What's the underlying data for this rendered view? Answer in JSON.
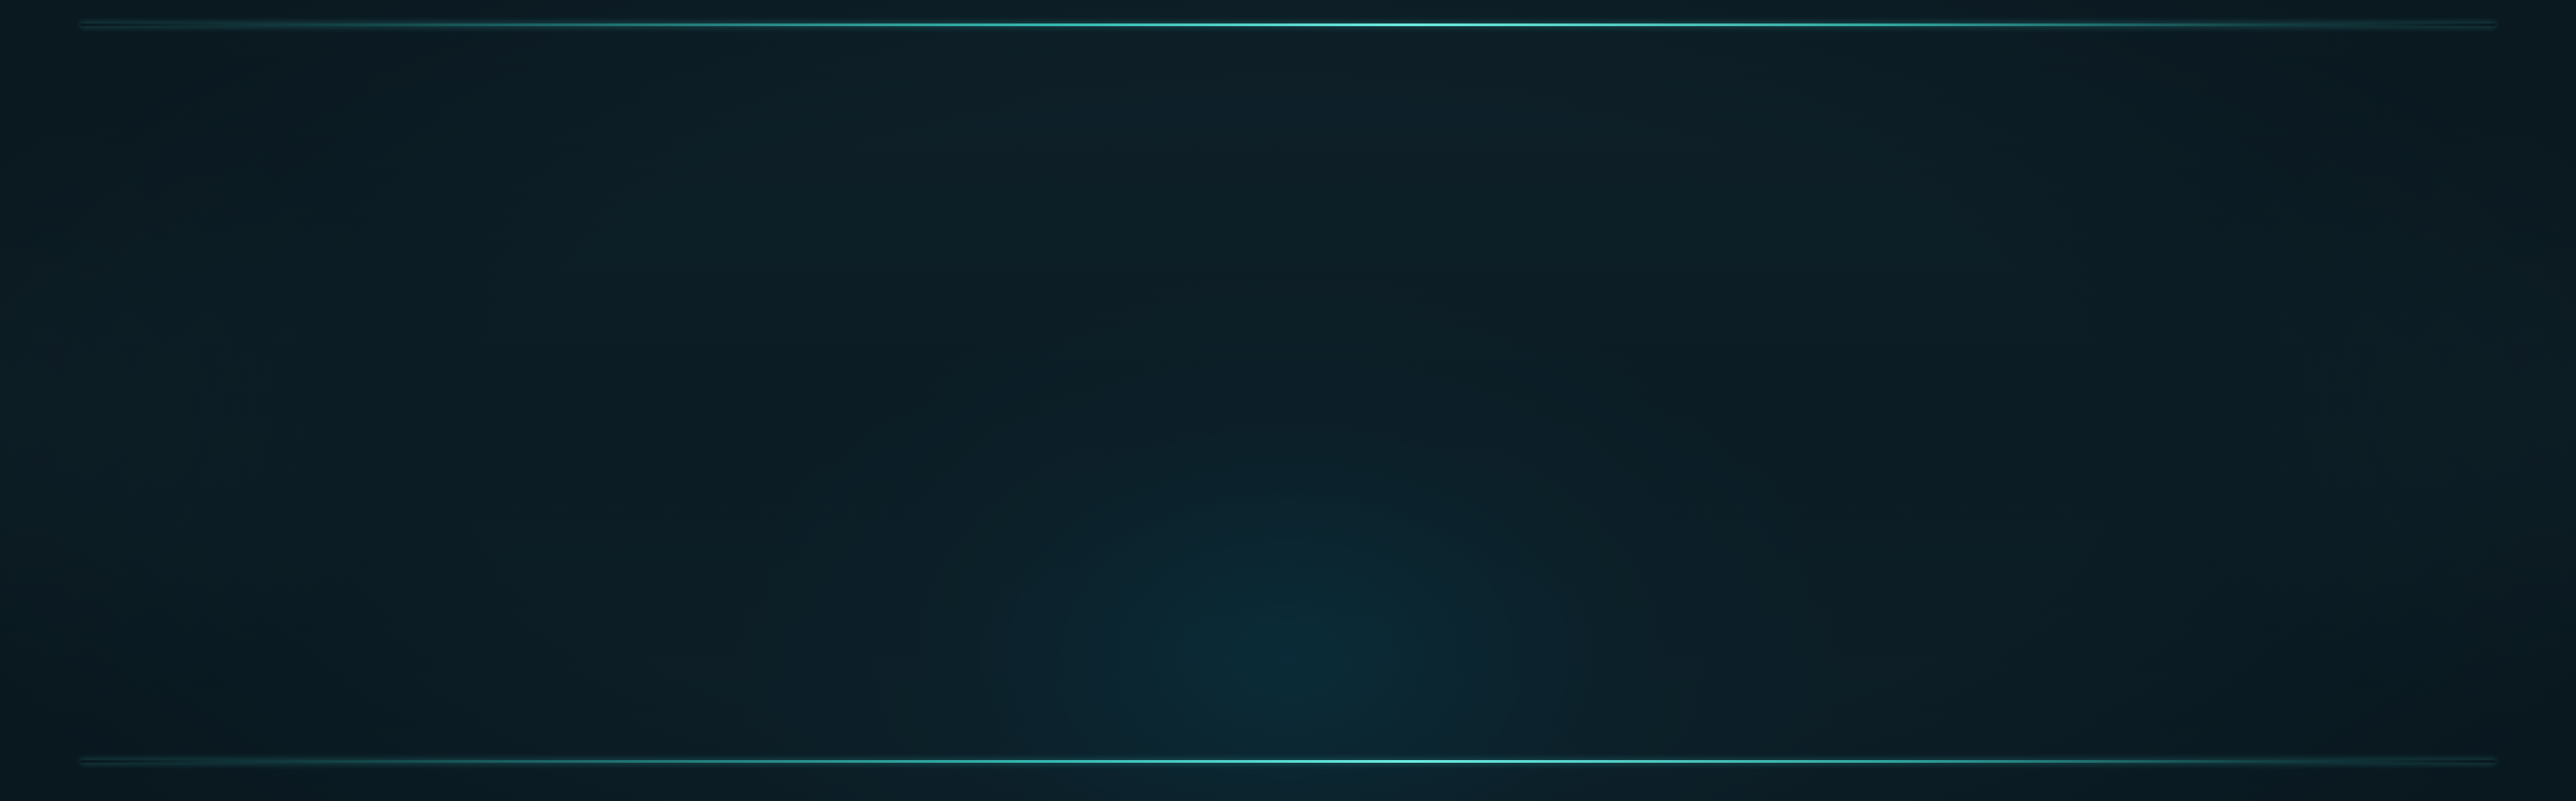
{
  "colors": {
    "background": "#0c1d25",
    "center_glow": "#0a2c38",
    "accent": "#4fd6cb"
  }
}
